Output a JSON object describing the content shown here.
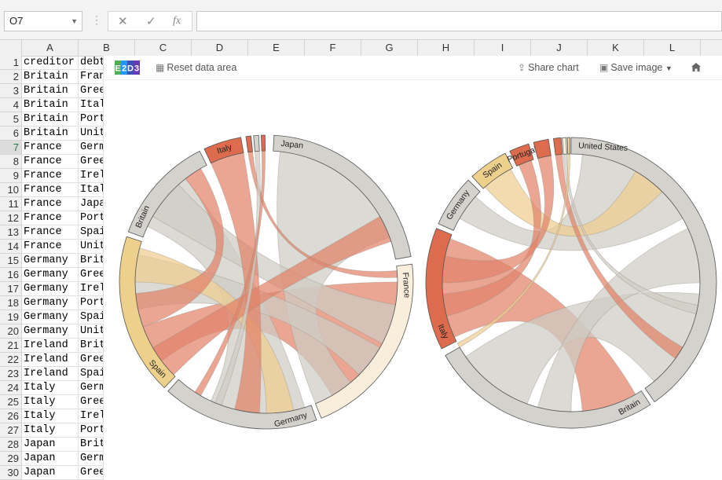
{
  "formula_bar": {
    "name_box": "O7",
    "cancel_icon": "✕",
    "enter_icon": "✓",
    "fx_label": "fx",
    "formula": ""
  },
  "columns": [
    "A",
    "B",
    "C",
    "D",
    "E",
    "F",
    "G",
    "H",
    "I",
    "J",
    "K",
    "L"
  ],
  "sheet_rows": [
    {
      "num": "1",
      "a": "creditor",
      "b": "debt"
    },
    {
      "num": "2",
      "a": "Britain",
      "b": "Fran"
    },
    {
      "num": "3",
      "a": "Britain",
      "b": "Gree"
    },
    {
      "num": "4",
      "a": "Britain",
      "b": "Ital"
    },
    {
      "num": "5",
      "a": "Britain",
      "b": "Port"
    },
    {
      "num": "6",
      "a": "Britain",
      "b": "Unit"
    },
    {
      "num": "7",
      "a": "France",
      "b": "Germ"
    },
    {
      "num": "8",
      "a": "France",
      "b": "Gree"
    },
    {
      "num": "9",
      "a": "France",
      "b": "Irel"
    },
    {
      "num": "10",
      "a": "France",
      "b": "Ital"
    },
    {
      "num": "11",
      "a": "France",
      "b": "Japa"
    },
    {
      "num": "12",
      "a": "France",
      "b": "Port"
    },
    {
      "num": "13",
      "a": "France",
      "b": "Spai"
    },
    {
      "num": "14",
      "a": "France",
      "b": "Unit"
    },
    {
      "num": "15",
      "a": "Germany",
      "b": "Brit"
    },
    {
      "num": "16",
      "a": "Germany",
      "b": "Gree"
    },
    {
      "num": "17",
      "a": "Germany",
      "b": "Irel"
    },
    {
      "num": "18",
      "a": "Germany",
      "b": "Port"
    },
    {
      "num": "19",
      "a": "Germany",
      "b": "Spai"
    },
    {
      "num": "20",
      "a": "Germany",
      "b": "Unit"
    },
    {
      "num": "21",
      "a": "Ireland",
      "b": "Brit"
    },
    {
      "num": "22",
      "a": "Ireland",
      "b": "Gree"
    },
    {
      "num": "23",
      "a": "Ireland",
      "b": "Spai"
    },
    {
      "num": "24",
      "a": "Italy",
      "b": "Germ"
    },
    {
      "num": "25",
      "a": "Italy",
      "b": "Gree"
    },
    {
      "num": "26",
      "a": "Italy",
      "b": "Irel"
    },
    {
      "num": "27",
      "a": "Italy",
      "b": "Port"
    },
    {
      "num": "28",
      "a": "Japan",
      "b": "Brit"
    },
    {
      "num": "29",
      "a": "Japan",
      "b": "Germ"
    },
    {
      "num": "30",
      "a": "Japan",
      "b": "Gree"
    }
  ],
  "addin": {
    "logo": [
      "E",
      "2",
      "D",
      "3"
    ],
    "reset_label": "Reset data area",
    "share_label": "Share chart",
    "save_label": "Save image",
    "home_icon": "home-icon"
  },
  "colors": {
    "selected_row_text": "#217346",
    "grey_arc": "#d4d2cc",
    "italy": "#dd6b4d",
    "spain": "#ecd08c",
    "france": "#f8eedb",
    "grey_ribbon": "#cfccc4",
    "italy_ribbon": "#e2826a",
    "spain_ribbon": "#efcd90",
    "france_ribbon": "#f0d8b0"
  },
  "chart_data": [
    {
      "type": "chord",
      "groups": [
        {
          "name": "Japan",
          "start": 3,
          "end": 80,
          "color": "#d4d2cc"
        },
        {
          "name": "France",
          "start": 83,
          "end": 158,
          "color": "#f8eedb"
        },
        {
          "name": "Germany",
          "start": 160,
          "end": 222,
          "color": "#d4d2cc"
        },
        {
          "name": "Spain",
          "start": 224,
          "end": 288,
          "color": "#ecd08c"
        },
        {
          "name": "Britain",
          "start": 290,
          "end": 333,
          "color": "#d4d2cc"
        },
        {
          "name": "Italy",
          "start": 335,
          "end": 350,
          "color": "#dd6b4d"
        },
        {
          "name": "",
          "start": 352,
          "end": 354,
          "color": "#dd6b4d"
        },
        {
          "name": "",
          "start": 355,
          "end": 357,
          "color": "#d4d2cc"
        },
        {
          "name": "",
          "start": 358,
          "end": 359.5,
          "color": "#dd6b4d"
        }
      ],
      "ribbons": [
        {
          "s1": 90,
          "s2": 150,
          "t1": 233,
          "t2": 250,
          "color": "#e2826a"
        },
        {
          "s1": 6,
          "s2": 70,
          "t1": 140,
          "t2": 158,
          "color": "#cfccc4"
        },
        {
          "s1": 163,
          "s2": 205,
          "t1": 295,
          "t2": 322,
          "color": "#cfccc4"
        },
        {
          "s1": 258,
          "s2": 282,
          "t1": 120,
          "t2": 135,
          "color": "#cfccc4"
        },
        {
          "s1": 270,
          "s2": 285,
          "t1": 168,
          "t2": 180,
          "color": "#efcd90"
        },
        {
          "s1": 300,
          "s2": 318,
          "t1": 100,
          "t2": 118,
          "color": "#cfccc4"
        },
        {
          "s1": 335,
          "s2": 350,
          "t1": 183,
          "t2": 194,
          "color": "#e2826a"
        },
        {
          "s1": 225,
          "s2": 240,
          "t1": 60,
          "t2": 72,
          "color": "#e2826a"
        },
        {
          "s1": 322,
          "s2": 330,
          "t1": 250,
          "t2": 265,
          "color": "#e2826a"
        },
        {
          "s1": 352,
          "s2": 354,
          "t1": 85,
          "t2": 88,
          "color": "#e2826a"
        },
        {
          "s1": 355,
          "s2": 357,
          "t1": 200,
          "t2": 203,
          "color": "#cfccc4"
        },
        {
          "s1": 358,
          "s2": 359.5,
          "t1": 210,
          "t2": 213,
          "color": "#e2826a"
        }
      ]
    },
    {
      "type": "chord",
      "groups": [
        {
          "name": "United States",
          "start": 0,
          "end": 145,
          "color": "#d4d2cc"
        },
        {
          "name": "Britain",
          "start": 147,
          "end": 240,
          "color": "#d4d2cc"
        },
        {
          "name": "Italy",
          "start": 243,
          "end": 292,
          "color": "#dd6b4d"
        },
        {
          "name": "Germany",
          "start": 294,
          "end": 315,
          "color": "#d4d2cc"
        },
        {
          "name": "Spain",
          "start": 317,
          "end": 333,
          "color": "#ecd08c"
        },
        {
          "name": "Portugal",
          "start": 335,
          "end": 343,
          "color": "#dd6b4d"
        },
        {
          "name": "",
          "start": 345,
          "end": 351,
          "color": "#dd6b4d"
        },
        {
          "name": "",
          "start": 353,
          "end": 356,
          "color": "#dd6b4d"
        },
        {
          "name": "",
          "start": 356.5,
          "end": 358,
          "color": "#f8eedb"
        },
        {
          "name": "",
          "start": 358.5,
          "end": 359.5,
          "color": "#ecd08c"
        }
      ],
      "ribbons": [
        {
          "s1": 245,
          "s2": 290,
          "t1": 150,
          "t2": 175,
          "color": "#e2826a"
        },
        {
          "s1": 5,
          "s2": 60,
          "t1": 300,
          "t2": 312,
          "color": "#cfccc4"
        },
        {
          "s1": 95,
          "s2": 140,
          "t1": 200,
          "t2": 235,
          "color": "#cfccc4"
        },
        {
          "s1": 65,
          "s2": 90,
          "t1": 180,
          "t2": 195,
          "color": "#cfccc4"
        },
        {
          "s1": 318,
          "s2": 332,
          "t1": 30,
          "t2": 45,
          "color": "#efcd90"
        },
        {
          "s1": 336,
          "s2": 342,
          "t1": 255,
          "t2": 265,
          "color": "#e2826a"
        },
        {
          "s1": 345,
          "s2": 351,
          "t1": 270,
          "t2": 282,
          "color": "#e2826a"
        },
        {
          "s1": 353,
          "s2": 356,
          "t1": 120,
          "t2": 126,
          "color": "#e2826a"
        },
        {
          "s1": 356.5,
          "s2": 358,
          "t1": 100,
          "t2": 104,
          "color": "#cfccc4"
        },
        {
          "s1": 358.5,
          "s2": 359.5,
          "t1": 240,
          "t2": 242,
          "color": "#efcd90"
        }
      ]
    }
  ]
}
